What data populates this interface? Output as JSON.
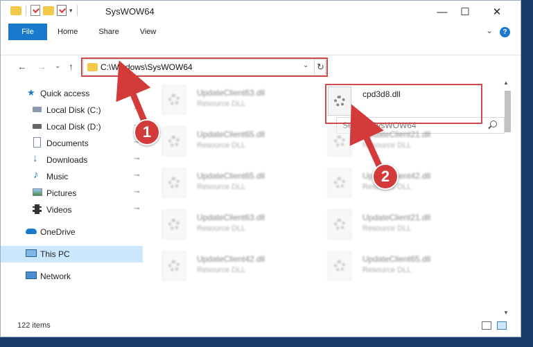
{
  "window": {
    "title": "SysWOW64",
    "controls": {
      "minimize": "—",
      "maximize": "☐",
      "close": "✕"
    }
  },
  "ribbon": {
    "tabs": [
      "File",
      "Home",
      "Share",
      "View"
    ],
    "expand": "⌄",
    "help": "?"
  },
  "nav": {
    "back": "←",
    "forward": "→",
    "recent": "⌄",
    "up": "↑",
    "address": "C:\\Windows\\SysWOW64",
    "address_dropdown": "⌄",
    "refresh": "↻",
    "search_placeholder": "Search SysWOW64"
  },
  "sidebar": {
    "items": [
      {
        "label": "Quick access",
        "icon": "star-icon",
        "pinned": false
      },
      {
        "label": "Local Disk (C:)",
        "icon": "drive-icon",
        "pinned": true
      },
      {
        "label": "Local Disk (D:)",
        "icon": "drive-icon",
        "pinned": true
      },
      {
        "label": "Documents",
        "icon": "documents-icon",
        "pinned": true
      },
      {
        "label": "Downloads",
        "icon": "download-icon",
        "pinned": true
      },
      {
        "label": "Music",
        "icon": "music-icon",
        "pinned": true
      },
      {
        "label": "Pictures",
        "icon": "pictures-icon",
        "pinned": true
      },
      {
        "label": "Videos",
        "icon": "videos-icon",
        "pinned": true
      },
      {
        "label": "OneDrive",
        "icon": "cloud-icon",
        "pinned": false
      },
      {
        "label": "This PC",
        "icon": "computer-icon",
        "pinned": false
      },
      {
        "label": "Network",
        "icon": "network-icon",
        "pinned": false
      }
    ],
    "pin_glyph": "📌"
  },
  "files": {
    "left_column": [
      {
        "name": "UpdateClient63.dll",
        "type": "Resource DLL"
      },
      {
        "name": "UpdateClient65.dll",
        "type": "Resource DLL"
      },
      {
        "name": "UpdateClient65.dll",
        "type": "Resource DLL"
      },
      {
        "name": "UpdateClient63.dll",
        "type": "Resource DLL"
      },
      {
        "name": "UpdateClient42.dll",
        "type": "Resource DLL"
      }
    ],
    "right_column": [
      {
        "name": "cpd3d8.dll",
        "type": ""
      },
      {
        "name": "UpdateClient21.dll",
        "type": "Resource DLL"
      },
      {
        "name": "UpdateClient42.dll",
        "type": "Resource DLL"
      },
      {
        "name": "UpdateClient21.dll",
        "type": "Resource DLL"
      },
      {
        "name": "UpdateClient65.dll",
        "type": "Resource DLL"
      }
    ]
  },
  "status": {
    "item_count": "122 items"
  },
  "callouts": [
    "1",
    "2"
  ],
  "colors": {
    "accent": "#1979ca",
    "highlight": "#d14a4a",
    "callout": "#d33b3b",
    "selected": "#cce8ff"
  }
}
